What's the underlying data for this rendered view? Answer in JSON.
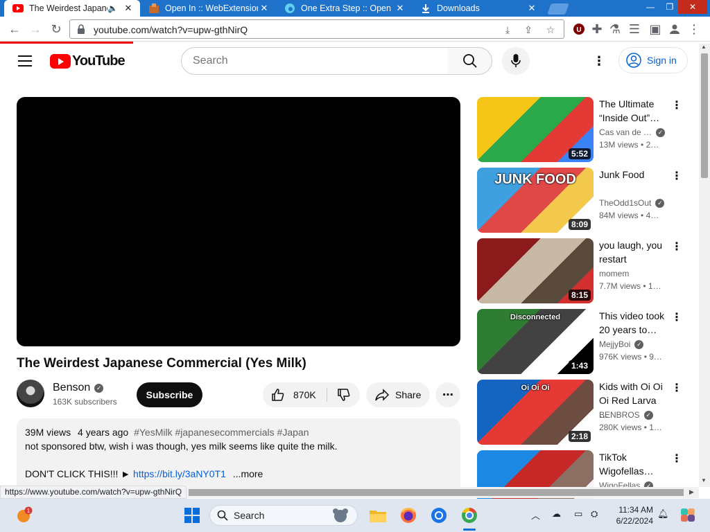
{
  "browser": {
    "tabs": [
      {
        "title": "The Weirdest Japanese Commercial",
        "icon": "youtube-icon",
        "active": true,
        "audio": true
      },
      {
        "title": "Open In :: WebExtensions",
        "icon": "extension-puzzle-icon",
        "active": false
      },
      {
        "title": "One Extra Step :: Open",
        "icon": "edge-icon",
        "active": false
      },
      {
        "title": "Downloads",
        "icon": "download-icon",
        "active": false
      }
    ],
    "url": "youtube.com/watch?v=upw-gthNirQ",
    "status_url": "https://www.youtube.com/watch?v=upw-gthNirQ"
  },
  "yt": {
    "logo_text": "YouTube",
    "search_placeholder": "Search",
    "signin_label": "Sign in"
  },
  "video": {
    "title": "The Weirdest Japanese Commercial (Yes Milk)",
    "channel": "Benson",
    "subscribers": "163K subscribers",
    "subscribe_label": "Subscribe",
    "likes": "870K",
    "share_label": "Share",
    "views": "39M views",
    "age": "4 years ago",
    "tags": "#YesMilk #japanesecommercials #Japan",
    "desc_line1": "not sponsored btw, wish i was though, yes milk seems like quite the milk.",
    "desc_line2_prefix": "DON'T CLICK THIS!!! ►",
    "desc_link": "https://bit.ly/3aNY0T1",
    "more_label": "...more"
  },
  "sidebar": [
    {
      "title": "The Ultimate “Inside Out”…",
      "channel": "Cas van de …",
      "verified": true,
      "views": "13M views",
      "age": "2…",
      "duration": "5:52",
      "colors": [
        "#f5c518",
        "#2aa84a",
        "#e53935",
        "#3b82f6"
      ]
    },
    {
      "title": "Junk Food",
      "channel": "TheOdd1sOut",
      "verified": true,
      "views": "84M views",
      "age": "4…",
      "duration": "8:09",
      "thumb_text": "JUNK FOOD",
      "colors": [
        "#3fa0e0",
        "#e04848",
        "#f2c94c",
        "#ffffff"
      ]
    },
    {
      "title": "you laugh, you restart",
      "channel": "momem",
      "verified": false,
      "views": "7.7M views",
      "age": "1…",
      "duration": "8:15",
      "colors": [
        "#8b1a1a",
        "#c7b8a5",
        "#5a4a3c",
        "#d32f2f"
      ]
    },
    {
      "title": "This video took 20 years to…",
      "channel": "MejjyBoi",
      "verified": true,
      "views": "976K views",
      "age": "9…",
      "duration": "1:43",
      "thumb_text": "Disconnected",
      "colors": [
        "#2e7d32",
        "#424242",
        "#ffffff",
        "#000000"
      ]
    },
    {
      "title": "Kids with Oi Oi Oi Red Larva …",
      "channel": "BENBROS",
      "verified": true,
      "views": "280K views",
      "age": "1…",
      "duration": "2:18",
      "thumb_text": "Oi Oi Oi",
      "colors": [
        "#1565c0",
        "#e53935",
        "#6d4c41",
        "#ffffff"
      ]
    },
    {
      "title": "TikTok Wigofellas…",
      "channel": "WigoFellas",
      "verified": true,
      "views": "",
      "age": "",
      "duration": "",
      "colors": [
        "#1e88e5",
        "#c62828",
        "#8d6e63",
        "#f5f5f5"
      ]
    }
  ],
  "taskbar": {
    "search_label": "Search",
    "time": "11:34 AM",
    "date": "6/22/2024",
    "notification_count": "1"
  }
}
